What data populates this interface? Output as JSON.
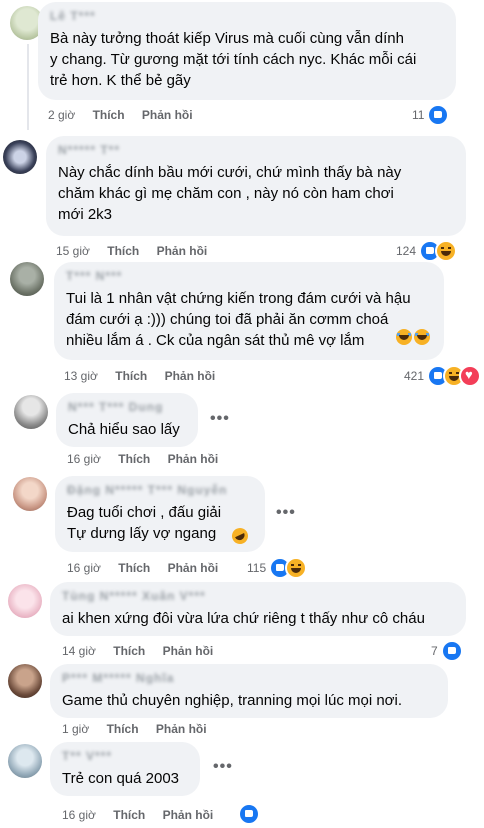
{
  "labels": {
    "like": "Thích",
    "reply": "Phản hồi",
    "more": "•••"
  },
  "comments": [
    {
      "name": "Lê T***",
      "text": "Bà này tưởng thoát kiếp Virus mà cuối cùng vẫn dính\ny chang. Từ gương mặt tới tính cách nyc. Khác mỗi cái\ntrẻ hơn. K thể bẻ gãy",
      "time": "2 giờ",
      "reactions": "11"
    },
    {
      "name": "N***** T**",
      "text": "Này chắc dính bầu mới cưới, chứ mình thấy bà này\nchăm khác gì mẹ chăm con , này nó còn ham chơi\nmới 2k3",
      "time": "15 giờ",
      "reactions": "124"
    },
    {
      "name": "T*** N***",
      "text": "Tui là 1 nhân vật chứng kiến trong đám cưới và hậu\nđám cưới ạ :))) chúng toi đã phải ăn cơmm choá\nnhiều lắm á . Ck của ngân sát thủ mê vợ lắm",
      "time": "13 giờ",
      "reactions": "421"
    },
    {
      "name": "N*** T*** Dung",
      "text": "Chả hiểu sao lấy",
      "time": "16 giờ",
      "reactions": ""
    },
    {
      "name": "Đặng N***** T*** Nguyễn",
      "text": "Đag tuổi chơi , đấu giải\nTự dưng lấy vợ ngang",
      "time": "16 giờ",
      "reactions": "115"
    },
    {
      "name": "Tùng N***** Xuân V***",
      "text": "ai khen xứng đôi vừa lứa chứ riêng t thấy như cô cháu",
      "time": "14 giờ",
      "reactions": "7"
    },
    {
      "name": "P*** M***** Nghĩa",
      "text": "Game thủ chuyên nghiệp, tranning mọi lúc mọi nơi.",
      "time": "1 giờ",
      "reactions": ""
    },
    {
      "name": "T** V***",
      "text": "Trẻ con quá 2003",
      "time": "16 giờ",
      "reactions": ""
    }
  ]
}
